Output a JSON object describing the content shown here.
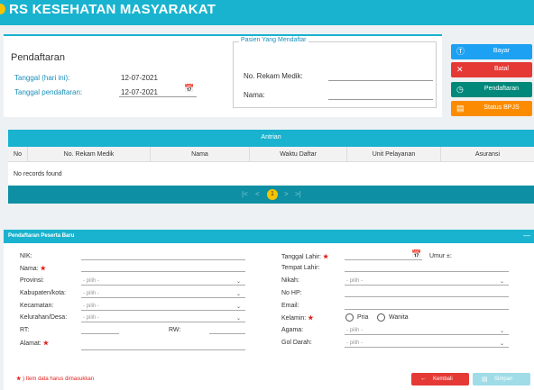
{
  "app": {
    "title": "RS KESEHATAN MASYARAKAT"
  },
  "pendaftaran": {
    "title": "Pendaftaran",
    "tanggal_hari_ini_label": "Tanggal (hari ini):",
    "tanggal_hari_ini_value": "12-07-2021",
    "tanggal_pendaftaran_label": "Tanggal pendaftaran:",
    "tanggal_pendaftaran_value": "12-07-2021"
  },
  "pasien_yang_mendaftar": {
    "legend": "Pasien Yang Mendaftar",
    "no_rekam_medik_label": "No. Rekam Medik:",
    "nama_label": "Nama:"
  },
  "actions": {
    "bayar": "Bayar",
    "batal": "Batal",
    "pendaftaran": "Pendaftaran",
    "status_bpjs": "Status BPJS"
  },
  "colors": {
    "primary": "#19b3cf",
    "bayar": "#1da1f2",
    "batal": "#e53935",
    "pendaftaran": "#00897b",
    "status_bpjs": "#fb8c00",
    "pager": "#0e8fa3"
  },
  "antrian": {
    "title": "Antrian",
    "columns": [
      "No",
      "No. Rekam Medik",
      "Nama",
      "Waktu Daftar",
      "Unit Pelayanan",
      "Asuransi"
    ],
    "empty_text": "No records found",
    "pager": {
      "first": "|<",
      "prev": "<",
      "current": "1",
      "next": ">",
      "last": ">|"
    }
  },
  "form": {
    "title": "Pendaftaran Peserta Baru",
    "nik_label": "NIK:",
    "nama_label": "Nama:",
    "provinsi_label": "Provinsi:",
    "kabupaten_label": "Kabupaten/kota:",
    "kecamatan_label": "Kecamatan:",
    "kelurahan_label": "Kelurahan/Desa:",
    "rt_label": "RT:",
    "rw_label": "RW:",
    "alamat_label": "Alamat:",
    "tanggal_lahir_label": "Tanggal Lahir:",
    "umur_label": "Umur ±:",
    "tempat_lahir_label": "Tempat Lahir:",
    "nikah_label": "Nikah:",
    "no_hp_label": "No HP:",
    "email_label": "Email:",
    "kelamin_label": "Kelamin:",
    "pria_label": "Pria",
    "wanita_label": "Wanita",
    "agama_label": "Agama:",
    "gol_darah_label": "Gol Darah:",
    "select_placeholder": "- pilih -",
    "required_note": ") Item data harus dimasukkan",
    "kembali": "Kembali",
    "simpan": "Simpan"
  },
  "icons": {
    "bayar": "dollar-circle-icon",
    "batal": "close-icon",
    "pendaftaran": "clock-icon",
    "status_bpjs": "monitor-icon",
    "calendar": "calendar-icon",
    "kembali": "arrow-left-icon",
    "simpan": "save-icon"
  }
}
